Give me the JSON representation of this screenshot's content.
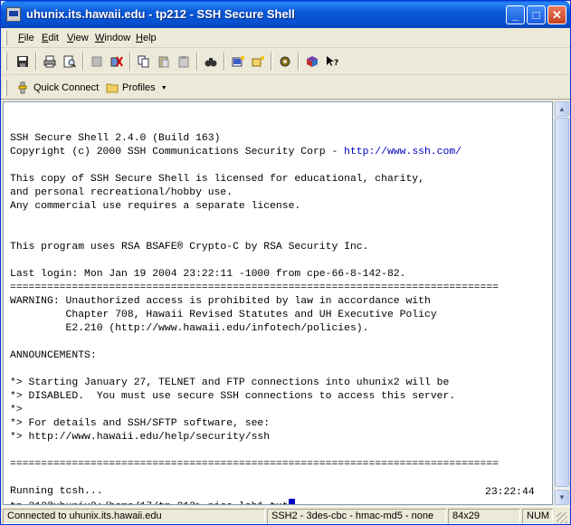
{
  "window": {
    "title": "uhunix.its.hawaii.edu - tp212 - SSH Secure Shell",
    "minimize_glyph": "_",
    "maximize_glyph": "□",
    "close_glyph": "✕"
  },
  "menu": {
    "items": [
      {
        "label": "File",
        "accel": "F",
        "rest": "ile"
      },
      {
        "label": "Edit",
        "accel": "E",
        "rest": "dit"
      },
      {
        "label": "View",
        "accel": "V",
        "rest": "iew"
      },
      {
        "label": "Window",
        "accel": "W",
        "rest": "indow"
      },
      {
        "label": "Help",
        "accel": "H",
        "rest": "elp"
      }
    ]
  },
  "toolbar": {
    "icons": [
      "save-icon",
      "print-icon",
      "print-preview-icon",
      "disconnect-icon",
      "connect-icon",
      "copy-icon",
      "paste-icon",
      "paste-special-icon",
      "find-icon",
      "new-terminal-window-icon",
      "new-file-transfer-icon",
      "settings-icon",
      "help-book-icon",
      "context-help-icon"
    ]
  },
  "profilebar": {
    "quick_connect_label": "Quick Connect",
    "profiles_label": "Profiles"
  },
  "terminal": {
    "lines": [
      "",
      "SSH Secure Shell 2.4.0 (Build 163)",
      "Copyright (c) 2000 SSH Communications Security Corp - ",
      "",
      "This copy of SSH Secure Shell is licensed for educational, charity,",
      "and personal recreational/hobby use.",
      "Any commercial use requires a separate license.",
      "",
      "",
      "This program uses RSA BSAFE® Crypto-C by RSA Security Inc.",
      "",
      "Last login: Mon Jan 19 2004 23:22:11 -1000 from cpe-66-8-142-82.",
      "===============================================================================",
      "WARNING: Unauthorized access is prohibited by law in accordance with",
      "         Chapter 708, Hawaii Revised Statutes and UH Executive Policy",
      "         E2.210 (http://www.hawaii.edu/infotech/policies).",
      "",
      "ANNOUNCEMENTS:",
      "",
      "*> Starting January 27, TELNET and FTP connections into uhunix2 will be",
      "*> DISABLED.  You must use secure SSH connections to access this server.",
      "*>",
      "*> For details and SSH/SFTP software, see:",
      "*> http://www.hawaii.edu/help/security/ssh",
      "",
      "===============================================================================",
      "",
      "Running tcsh...",
      "tp_212@uhunix2:/home/17/tp_212> pico lab1.txt"
    ],
    "copyright_link": "http://www.ssh.com/",
    "clock": "23:22:44"
  },
  "status": {
    "connection": "Connected to uhunix.its.hawaii.edu",
    "cipher": "SSH2 - 3des-cbc - hmac-md5 - none",
    "size": "84x29",
    "numlock": "NUM"
  },
  "colors": {
    "titlebar": "#0a58d8",
    "link": "#0000c0",
    "cursor": "#0000c0",
    "chrome": "#ece9d8"
  }
}
